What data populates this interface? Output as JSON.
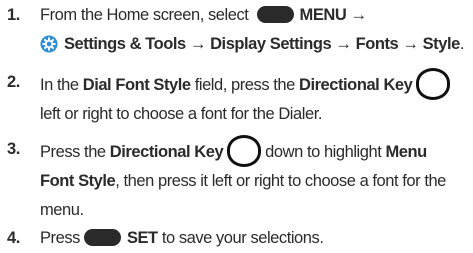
{
  "steps": [
    {
      "number": "1.",
      "line1": {
        "t1": "From the Home screen, select",
        "b1": "MENU",
        "a1": "→"
      },
      "line2": {
        "b1": "Settings & Tools",
        "a1": "→",
        "b2": "Display Settings",
        "a2": "→",
        "b3": "Fonts",
        "a3": "→",
        "b4": "Style",
        "end": "."
      }
    },
    {
      "number": "2.",
      "line1": {
        "t1": "In the",
        "b1": "Dial Font Style",
        "t2": "field, press the",
        "b2": "Directional Key"
      },
      "line2": {
        "t1": "left or right to choose a font for the Dialer."
      }
    },
    {
      "number": "3.",
      "line1": {
        "t1": "Press the",
        "b1": "Directional Key",
        "t2": "down to highlight",
        "b2": "Menu"
      },
      "line2": {
        "b1": "Font Style",
        "t1": ", then press it left or right to choose a font for the"
      },
      "line3": {
        "t1": "menu."
      }
    },
    {
      "number": "4.",
      "line1": {
        "t1": "Press",
        "b1": "SET",
        "t2": "to save your selections."
      }
    }
  ],
  "icons": {
    "softkey": "soft-key-button-icon",
    "dirkey": "directional-key-icon",
    "settings": "settings-gear-icon"
  }
}
